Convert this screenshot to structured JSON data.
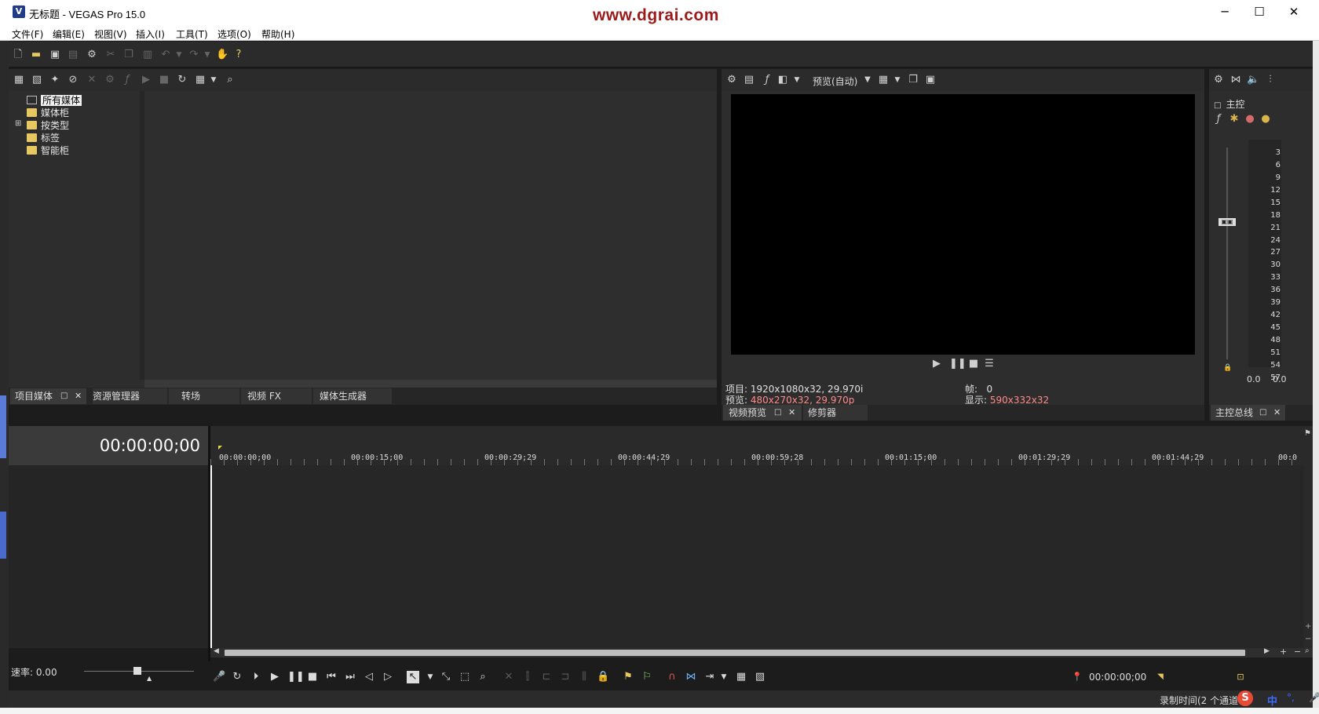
{
  "window": {
    "title": "无标题 - VEGAS Pro 15.0",
    "app_icon": "V",
    "watermark": "www.dgrai.com",
    "minimize": "─",
    "maximize": "☐",
    "close": "✕"
  },
  "menu": [
    "文件(F)",
    "编辑(E)",
    "视图(V)",
    "插入(I)",
    "工具(T)",
    "选项(O)",
    "帮助(H)"
  ],
  "media_panel": {
    "tree": [
      "所有媒体",
      "媒体柜",
      "按类型",
      "标签",
      "智能柜"
    ],
    "expand_icon": "⊞",
    "tabs": [
      "项目媒体",
      "资源管理器",
      "转场",
      "视频 FX",
      "媒体生成器"
    ]
  },
  "preview_panel": {
    "preview_mode": "预览(自动)",
    "project_label": "项目:",
    "project_value": "1920x1080x32, 29.970i",
    "preview_label": "预览:",
    "preview_value": "480x270x32, 29.970p",
    "frame_label": "帧:",
    "frame_value": "0",
    "display_label": "显示:",
    "display_value": "590x332x32",
    "tabs": [
      "视频预览",
      "修剪器"
    ]
  },
  "master_panel": {
    "title": "主控",
    "scale": [
      "3",
      "6",
      "9",
      "12",
      "15",
      "18",
      "21",
      "24",
      "27",
      "30",
      "33",
      "36",
      "39",
      "42",
      "45",
      "48",
      "51",
      "54",
      "57"
    ],
    "level_left": "0.0",
    "level_right": "0.0",
    "tab": "主控总线"
  },
  "timeline": {
    "timecode": "00:00:00;00",
    "ruler": [
      "00:00:00;00",
      "00:00:15;00",
      "00:00:29;29",
      "00:00:44;29",
      "00:00:59;28",
      "00:01:15;00",
      "00:01:29;29",
      "00:01:44;29",
      "00:0"
    ],
    "rate_label": "速率: 0.00",
    "cursor_time": "00:00:00;00"
  },
  "status": {
    "record_time": "录制时间(2 个通道",
    "ime_mode": "中"
  },
  "colors": {
    "accent_red": "#ff8a8a",
    "watermark": "#9b1b1b",
    "folder": "#e7c75f"
  }
}
